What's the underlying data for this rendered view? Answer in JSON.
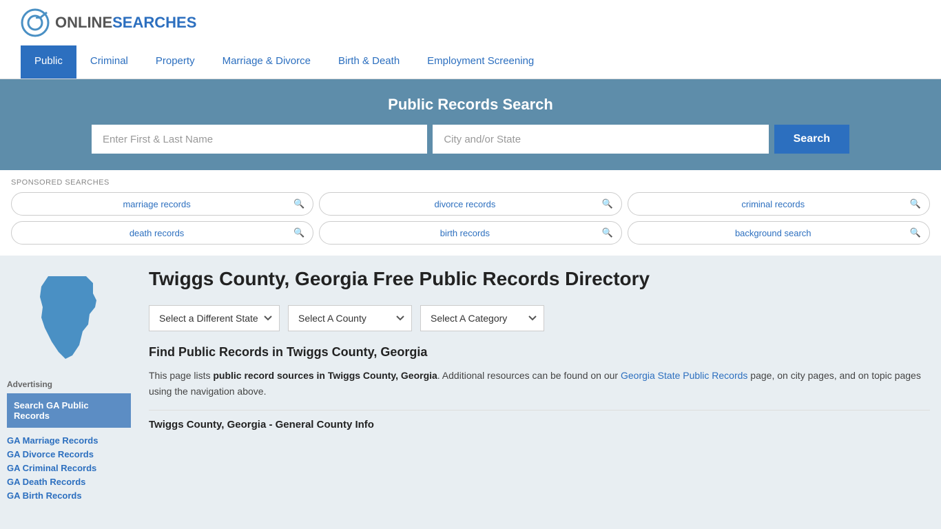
{
  "header": {
    "logo_online": "ONLINE",
    "logo_searches": "SEARCHES",
    "logo_alt": "OnlineSearches"
  },
  "nav": {
    "items": [
      {
        "label": "Public",
        "active": true
      },
      {
        "label": "Criminal",
        "active": false
      },
      {
        "label": "Property",
        "active": false
      },
      {
        "label": "Marriage & Divorce",
        "active": false
      },
      {
        "label": "Birth & Death",
        "active": false
      },
      {
        "label": "Employment Screening",
        "active": false
      }
    ]
  },
  "search_banner": {
    "title": "Public Records Search",
    "name_placeholder": "Enter First & Last Name",
    "location_placeholder": "City and/or State",
    "button_label": "Search"
  },
  "sponsored": {
    "label": "SPONSORED SEARCHES",
    "pills": [
      {
        "label": "marriage records"
      },
      {
        "label": "divorce records"
      },
      {
        "label": "criminal records"
      },
      {
        "label": "death records"
      },
      {
        "label": "birth records"
      },
      {
        "label": "background search"
      }
    ]
  },
  "sidebar": {
    "ad_label": "Advertising",
    "ad_box_label": "Search GA Public Records",
    "links": [
      {
        "label": "GA Marriage Records"
      },
      {
        "label": "GA Divorce Records"
      },
      {
        "label": "GA Criminal Records"
      },
      {
        "label": "GA Death Records"
      },
      {
        "label": "GA Birth Records"
      }
    ]
  },
  "directory": {
    "page_title": "Twiggs County, Georgia Free Public Records Directory",
    "dropdown_state": "Select a Different State",
    "dropdown_county": "Select A County",
    "dropdown_category": "Select A Category",
    "find_title": "Find Public Records in Twiggs County, Georgia",
    "description_part1": "This page lists ",
    "description_bold1": "public record sources in Twiggs County, Georgia",
    "description_part2": ". Additional resources can be found on our ",
    "description_link": "Georgia State Public Records",
    "description_part3": " page, on city pages, and on topic pages using the navigation above.",
    "section_subtitle": "Twiggs County, Georgia - General County Info"
  }
}
